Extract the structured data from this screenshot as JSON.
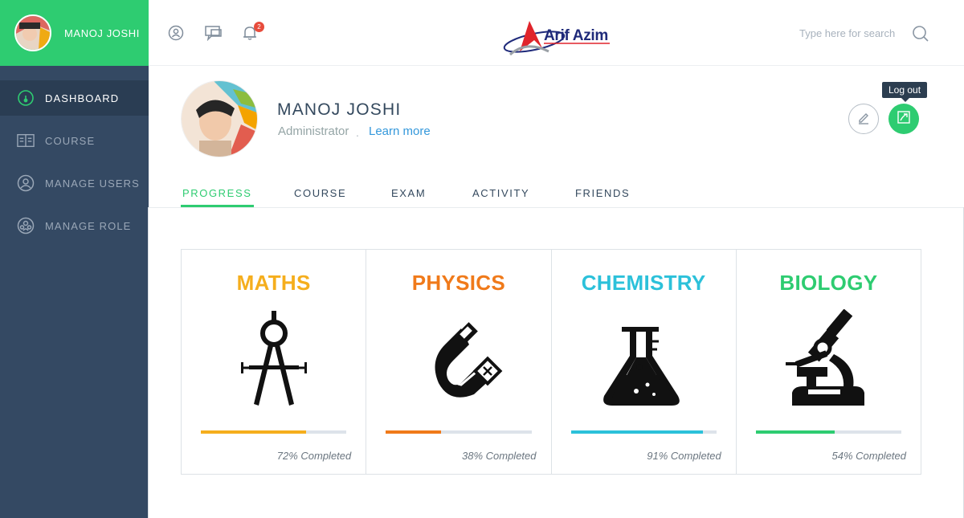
{
  "sidebar": {
    "user_name": "MANOJ JOSHI",
    "items": [
      {
        "label": "DASHBOARD",
        "icon": "dashboard-gauge-icon",
        "active": true
      },
      {
        "label": "COURSE",
        "icon": "book-icon",
        "active": false
      },
      {
        "label": "MANAGE USERS",
        "icon": "users-icon",
        "active": false
      },
      {
        "label": "MANAGE ROLE",
        "icon": "role-icon",
        "active": false
      }
    ]
  },
  "header": {
    "logo_text": "Arif Azim",
    "notification_count": "2",
    "search_placeholder": "Type here for search",
    "icons": [
      "user-icon",
      "chat-icon",
      "bell-icon",
      "search-icon"
    ]
  },
  "profile": {
    "name": "MANOJ JOSHI",
    "role": "Administrator",
    "separator": ".",
    "link": "Learn more",
    "tooltip": "Log out"
  },
  "tabs": [
    {
      "label": "PROGRESS",
      "active": true
    },
    {
      "label": "COURSE",
      "active": false
    },
    {
      "label": "EXAM",
      "active": false
    },
    {
      "label": "ACTIVITY",
      "active": false
    },
    {
      "label": "FRIENDS",
      "active": false
    }
  ],
  "subjects": [
    {
      "title": "MATHS",
      "color": "#f5ae1d",
      "icon": "compass-icon",
      "progress": 0.72,
      "status": "72% Completed"
    },
    {
      "title": "PHYSICS",
      "color": "#f07a1a",
      "icon": "magnet-icon",
      "progress": 0.38,
      "status": "38% Completed"
    },
    {
      "title": "CHEMISTRY",
      "color": "#2cc1da",
      "icon": "flask-icon",
      "progress": 0.91,
      "status": "91% Completed"
    },
    {
      "title": "BIOLOGY",
      "color": "#2ecc71",
      "icon": "microscope-icon",
      "progress": 0.54,
      "status": "54% Completed"
    }
  ],
  "colors": {
    "accent": "#2ecc71",
    "sidebar": "#344963",
    "link": "#3498db",
    "track": "#dde3ea"
  }
}
